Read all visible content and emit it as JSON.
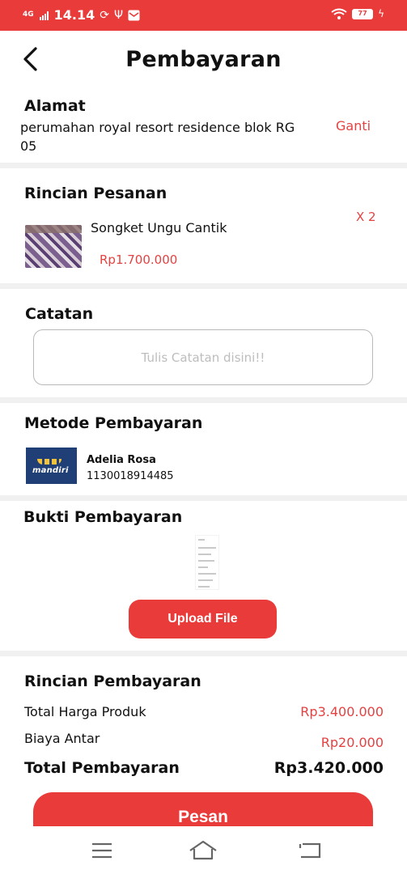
{
  "status_bar": {
    "network": "4G",
    "time": "14.14",
    "battery_level": "77",
    "icons": [
      "signal-icon",
      "sync-icon",
      "usb-icon",
      "mail-icon",
      "wifi-icon",
      "battery-icon",
      "charging-icon"
    ]
  },
  "header": {
    "title": "Pembayaran",
    "back_icon": "chevron-left-icon"
  },
  "address": {
    "title": "Alamat",
    "text": "perumahan royal resort residence blok RG 05",
    "change_label": "Ganti"
  },
  "order_details": {
    "title": "Rincian Pesanan",
    "items": [
      {
        "name": "Songket Ungu Cantik",
        "price": "Rp1.700.000",
        "quantity": "X 2"
      }
    ]
  },
  "notes": {
    "title": "Catatan",
    "placeholder": "Tulis Catatan disini!!",
    "value": ""
  },
  "payment_method": {
    "title": "Metode Pembayaran",
    "bank_logo_text": "mandiri",
    "account_name": "Adelia Rosa",
    "account_number": "1130018914485"
  },
  "payment_proof": {
    "title": "Bukti Pembayaran",
    "upload_label": "Upload File"
  },
  "payment_details": {
    "title": "Rincian Pembayaran",
    "rows": [
      {
        "label": "Total Harga Produk",
        "value": "Rp3.400.000"
      },
      {
        "label": "Biaya Antar",
        "value": "Rp20.000"
      }
    ],
    "total_label": "Total Pembayaran",
    "total_value": "Rp3.420.000"
  },
  "order_button": {
    "label": "Pesan"
  },
  "colors": {
    "accent": "#ea3b3b",
    "price_text": "#e44242",
    "divider": "#f0f0f0",
    "bank_blue": "#1f3f76",
    "bank_yellow": "#f3c23c"
  },
  "nav_bar": {
    "icons": [
      "menu-icon",
      "home-icon",
      "back-icon"
    ]
  }
}
